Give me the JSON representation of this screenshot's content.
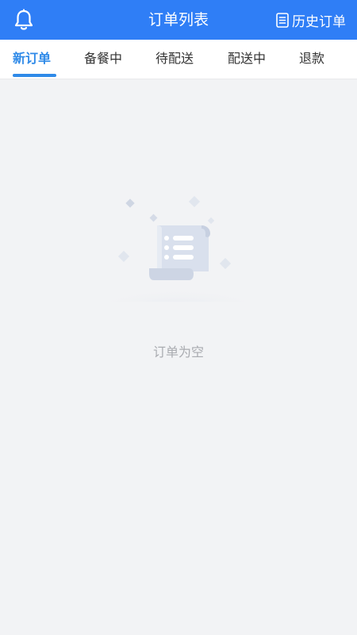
{
  "header": {
    "title": "订单列表",
    "history_label": "历史订单",
    "left_icon": "bell-icon",
    "history_icon": "document-list-icon",
    "background": "#2f7ef6"
  },
  "tabs": [
    {
      "label": "新订单",
      "active": true
    },
    {
      "label": "备餐中",
      "active": false
    },
    {
      "label": "待配送",
      "active": false
    },
    {
      "label": "配送中",
      "active": false
    },
    {
      "label": "退款",
      "active": false
    }
  ],
  "accent_color": "#2f8ae8",
  "empty_state": {
    "text": "订单为空",
    "icon": "empty-order-scroll-icon"
  }
}
